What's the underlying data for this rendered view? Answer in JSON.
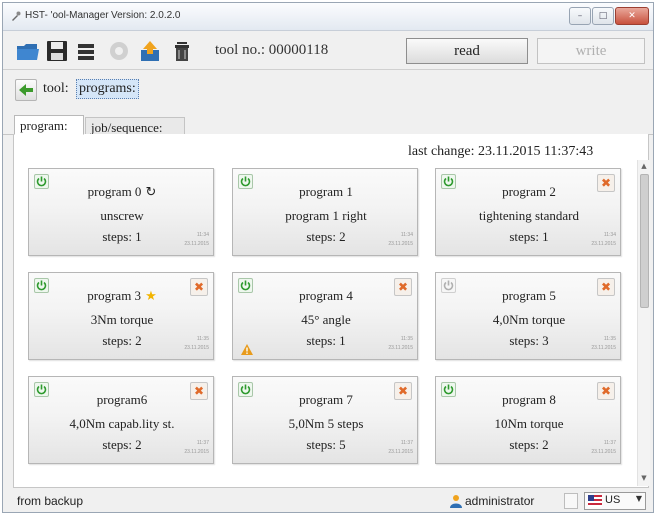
{
  "window": {
    "title": "HST- 'ool-Manager",
    "version": "Version: 2.0.2.0",
    "controls": {
      "minimize": "–",
      "maximize": "□",
      "close": "✕"
    }
  },
  "toolbar": {
    "icons": [
      "folder-open-icon",
      "save-icon",
      "list-icon",
      "gear-icon",
      "export-icon",
      "delete-icon"
    ],
    "tool_no_label": "tool no.: 00000118",
    "read_label": "read",
    "write_label": "write"
  },
  "breadcrumb": {
    "label": "tool:",
    "value": "programs:"
  },
  "tabs": [
    {
      "label": "program:"
    },
    {
      "label": "job/sequence:"
    }
  ],
  "last_change": "last change:  23.11.2015  11:37:43",
  "cards": [
    {
      "name": "program 0",
      "mark": "↻",
      "desc": "unscrew",
      "steps": "steps: 1",
      "time": "11:34",
      "date": "23.11.2015",
      "enabled": true,
      "deletable": false,
      "warning": false
    },
    {
      "name": "program 1",
      "mark": "",
      "desc": "program 1 right",
      "steps": "steps: 2",
      "time": "11:34",
      "date": "23.11.2015",
      "enabled": true,
      "deletable": false,
      "warning": false
    },
    {
      "name": "program 2",
      "mark": "",
      "desc": "tightening standard",
      "steps": "steps: 1",
      "time": "11:34",
      "date": "23.11.2015",
      "enabled": true,
      "deletable": true,
      "warning": false
    },
    {
      "name": "program 3",
      "mark": "★",
      "desc": "3Nm torque",
      "steps": "steps: 2",
      "time": "11:35",
      "date": "23.11.2015",
      "enabled": true,
      "deletable": true,
      "warning": false
    },
    {
      "name": "program 4",
      "mark": "",
      "desc": "45° angle",
      "steps": "steps: 1",
      "time": "11:35",
      "date": "23.11.2015",
      "enabled": true,
      "deletable": true,
      "warning": true
    },
    {
      "name": "program 5",
      "mark": "",
      "desc": "4,0Nm torque",
      "steps": "steps: 3",
      "time": "11:35",
      "date": "23.11.2015",
      "enabled": false,
      "deletable": true,
      "warning": false
    },
    {
      "name": "program6",
      "mark": "",
      "desc": "4,0Nm capab.lity st.",
      "steps": "steps: 2",
      "time": "11:37",
      "date": "23.11.2015",
      "enabled": true,
      "deletable": true,
      "warning": false
    },
    {
      "name": "program 7",
      "mark": "",
      "desc": "5,0Nm 5 steps",
      "steps": "steps: 5",
      "time": "11:37",
      "date": "23.11.2015",
      "enabled": true,
      "deletable": true,
      "warning": false
    },
    {
      "name": "program 8",
      "mark": "",
      "desc": "10Nm torque",
      "steps": "steps: 2",
      "time": "11:37",
      "date": "23.11.2015",
      "enabled": true,
      "deletable": true,
      "warning": false
    }
  ],
  "colors": {
    "power_on": "#2e9a2e",
    "power_off": "#b0b0b0",
    "delete": "#e06a2a",
    "star": "#f2b400",
    "warning": "#e89b1c"
  },
  "statusbar": {
    "text": "from backup",
    "user": "administrator",
    "language": "US"
  },
  "scroll": {
    "position": 0.0,
    "visible_fraction": 0.45
  }
}
